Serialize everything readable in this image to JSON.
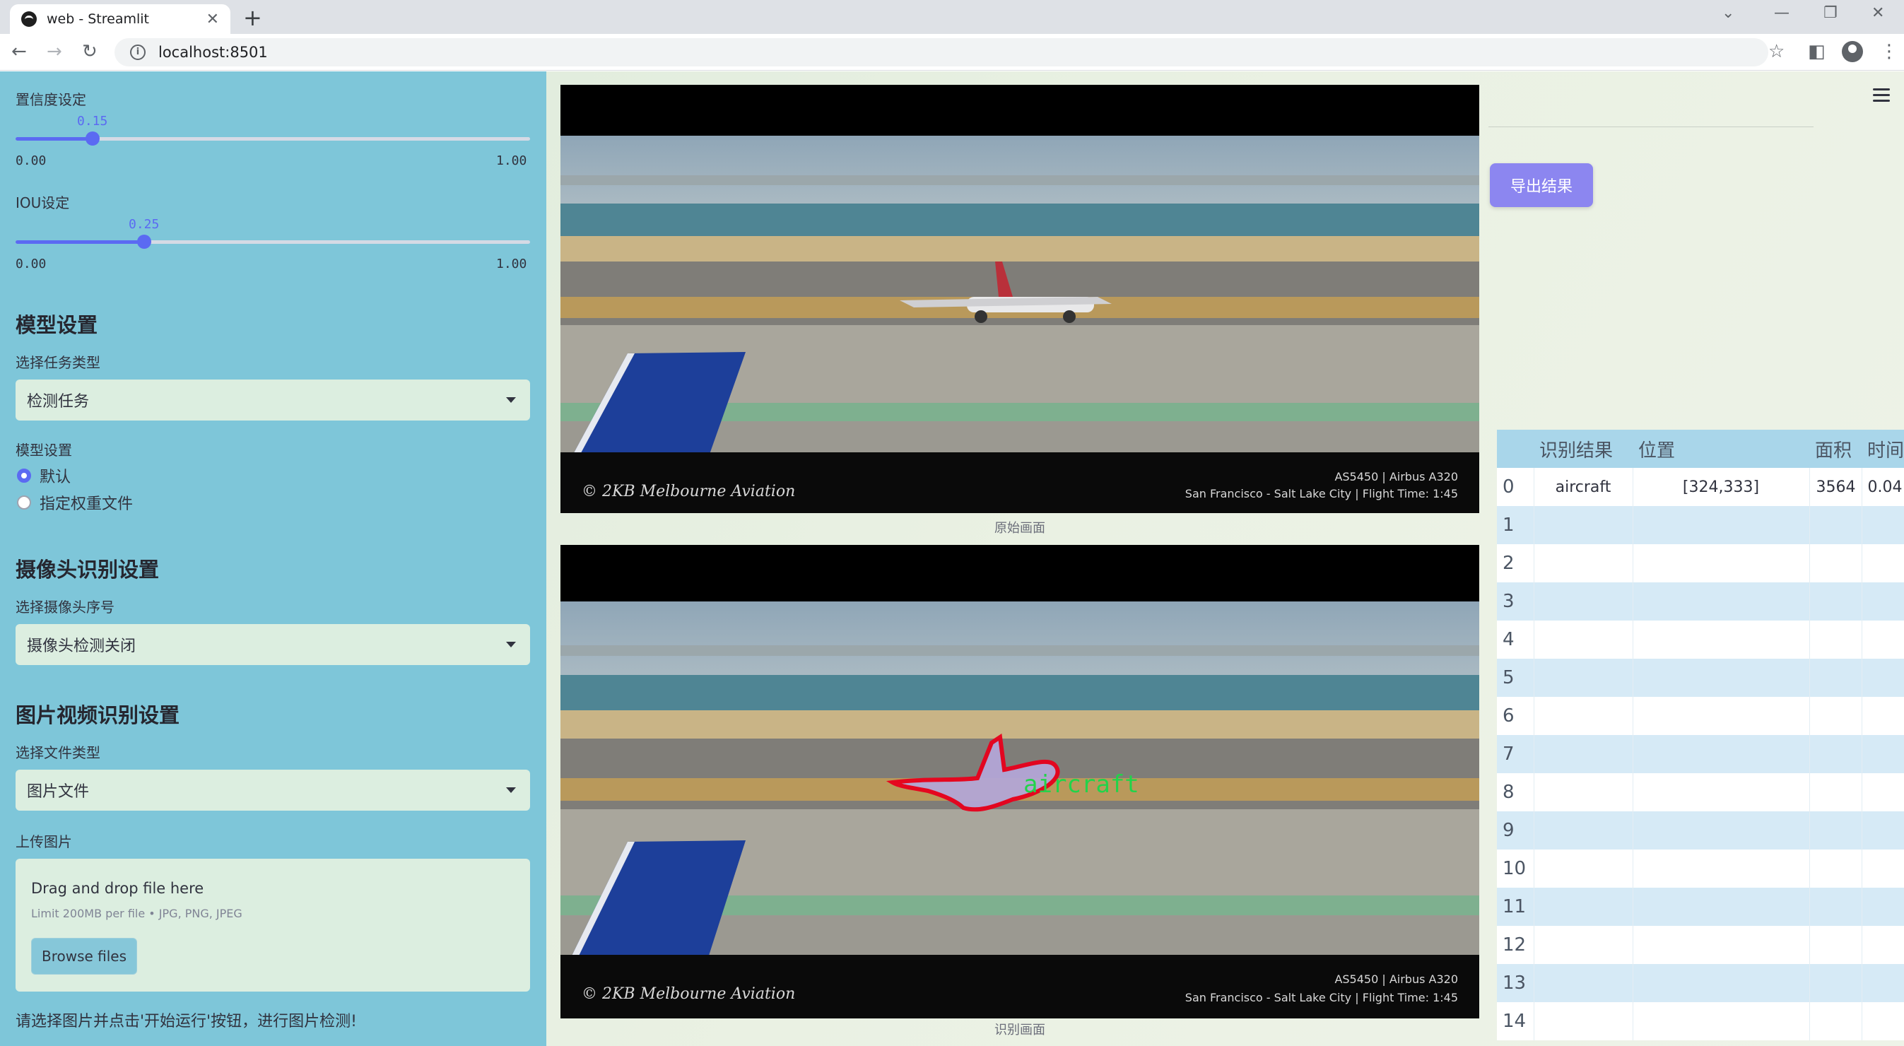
{
  "browser": {
    "tab_title": "web - Streamlit",
    "url": "localhost:8501"
  },
  "sidebar": {
    "conf_label": "置信度设定",
    "conf_value": "0.15",
    "conf_fraction": 0.15,
    "iou_label": "IOU设定",
    "iou_value": "0.25",
    "iou_fraction": 0.25,
    "range_min": "0.00",
    "range_max": "1.00",
    "model_section": "模型设置",
    "task_label": "选择任务类型",
    "task_value": "检测任务",
    "model_label": "模型设置",
    "radio_default": "默认",
    "radio_custom": "指定权重文件",
    "camera_section": "摄像头识别设置",
    "camera_label": "选择摄像头序号",
    "camera_value": "摄像头检测关闭",
    "media_section": "图片视频识别设置",
    "filetype_label": "选择文件类型",
    "filetype_value": "图片文件",
    "upload_label": "上传图片",
    "drop_text": "Drag and drop file here",
    "limit_text": "Limit 200MB per file • JPG, PNG, JPEG",
    "browse_label": "Browse files",
    "hint": "请选择图片并点击'开始运行'按钮，进行图片检测!"
  },
  "main": {
    "original_caption": "原始画面",
    "result_caption": "识别画面",
    "detection_label": "aircraft",
    "overlay_line1": "AS5450 | Airbus A320",
    "overlay_line2": "San Francisco - Salt Lake City | Flight Time: 1:45",
    "watermark": "© 2KB Melbourne Aviation",
    "export_label": "导出结果"
  },
  "table": {
    "headers": [
      "",
      "识别结果",
      "位置",
      "面积",
      "时间"
    ],
    "rows": [
      [
        "0",
        "aircraft",
        "[324,333]",
        "3564",
        "0.04"
      ],
      [
        "1",
        "",
        "",
        "",
        ""
      ],
      [
        "2",
        "",
        "",
        "",
        ""
      ],
      [
        "3",
        "",
        "",
        "",
        ""
      ],
      [
        "4",
        "",
        "",
        "",
        ""
      ],
      [
        "5",
        "",
        "",
        "",
        ""
      ],
      [
        "6",
        "",
        "",
        "",
        ""
      ],
      [
        "7",
        "",
        "",
        "",
        ""
      ],
      [
        "8",
        "",
        "",
        "",
        ""
      ],
      [
        "9",
        "",
        "",
        "",
        ""
      ],
      [
        "10",
        "",
        "",
        "",
        ""
      ],
      [
        "11",
        "",
        "",
        "",
        ""
      ],
      [
        "12",
        "",
        "",
        "",
        ""
      ],
      [
        "13",
        "",
        "",
        "",
        ""
      ],
      [
        "14",
        "",
        "",
        "",
        ""
      ]
    ]
  },
  "colors": {
    "sidebar_bg": "#7ec6d9",
    "accent": "#5b6af2",
    "export_button": "#8c86f0",
    "detection_mask": "#e8001c",
    "detection_text": "#22d34a"
  }
}
